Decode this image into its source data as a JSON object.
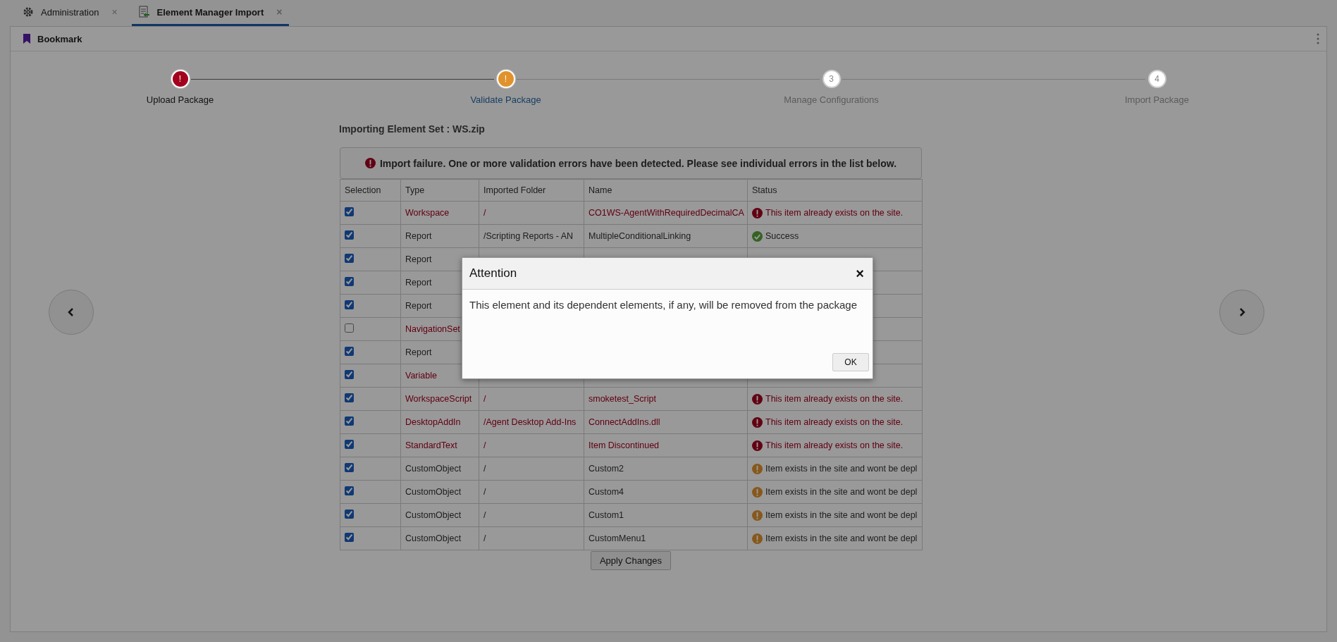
{
  "tabs": [
    {
      "label": "Administration",
      "selected": false,
      "close": "×"
    },
    {
      "label": "Element Manager Import",
      "selected": true,
      "close": "×"
    }
  ],
  "bookmark": {
    "label": "Bookmark"
  },
  "steps": [
    {
      "label": "Upload Package",
      "mark": "!",
      "kind": "error"
    },
    {
      "label": "Validate Package",
      "mark": "!",
      "kind": "warning"
    },
    {
      "label": "Manage Configurations",
      "mark": "3",
      "kind": "pending"
    },
    {
      "label": "Import Package",
      "mark": "4",
      "kind": "pending"
    }
  ],
  "title": "Importing Element Set : WS.zip",
  "alert": {
    "text": "Import failure. One or more validation errors have been detected. Please see individual errors in the list below."
  },
  "table": {
    "columns": [
      "Selection",
      "Type",
      "Imported Folder",
      "Name",
      "Status"
    ],
    "rows": [
      {
        "checked": true,
        "kind": "error",
        "type": "Workspace",
        "folder": "/",
        "name": "CO1WS-AgentWithRequiredDecimalCA",
        "status": "This item already exists on the site."
      },
      {
        "checked": true,
        "kind": "success",
        "type": "Report",
        "folder": "/Scripting Reports - AN",
        "name": "MultipleConditionalLinking",
        "status": "Success"
      },
      {
        "checked": true,
        "kind": "covered",
        "type": "Report"
      },
      {
        "checked": true,
        "kind": "covered",
        "type": "Report"
      },
      {
        "checked": true,
        "kind": "covered",
        "type": "Report"
      },
      {
        "checked": false,
        "kind": "covered",
        "type": "NavigationSet",
        "red": true
      },
      {
        "checked": true,
        "kind": "covered",
        "type": "Report"
      },
      {
        "checked": true,
        "kind": "covered",
        "type": "Variable",
        "red": true
      },
      {
        "checked": true,
        "kind": "error",
        "type": "WorkspaceScript",
        "folder": "/",
        "name": "smoketest_Script",
        "status": "This item already exists on the site."
      },
      {
        "checked": true,
        "kind": "error",
        "type": "DesktopAddIn",
        "folder": "/Agent Desktop Add-Ins",
        "name": "ConnectAddIns.dll",
        "status": "This item already exists on the site."
      },
      {
        "checked": true,
        "kind": "error",
        "type": "StandardText",
        "folder": "/",
        "name": "Item Discontinued",
        "status": "This item already exists on the site."
      },
      {
        "checked": true,
        "kind": "warning",
        "type": "CustomObject",
        "folder": "/",
        "name": "Custom2",
        "status": "Item exists in the site and wont be depl"
      },
      {
        "checked": true,
        "kind": "warning",
        "type": "CustomObject",
        "folder": "/",
        "name": "Custom4",
        "status": "Item exists in the site and wont be depl"
      },
      {
        "checked": true,
        "kind": "warning",
        "type": "CustomObject",
        "folder": "/",
        "name": "Custom1",
        "status": "Item exists in the site and wont be depl"
      },
      {
        "checked": true,
        "kind": "warning",
        "type": "CustomObject",
        "folder": "/",
        "name": "CustomMenu1",
        "status": "Item exists in the site and wont be depl"
      }
    ]
  },
  "apply_button": "Apply Changes",
  "dialog": {
    "title": "Attention",
    "close": "×",
    "message": "This element and its dependent elements, if any, will be removed from the package",
    "ok": "OK"
  }
}
